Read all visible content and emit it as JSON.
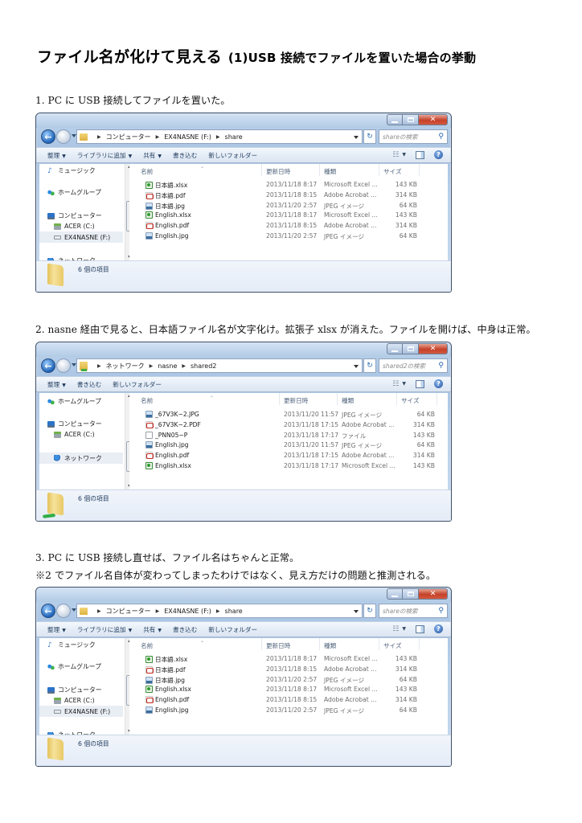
{
  "document": {
    "title": "ファイル名が化けて見える",
    "subtitle": "(1)USB 接続でファイルを置いた場合の挙動",
    "steps": [
      {
        "text": "1.  PC に USB 接続してファイルを置いた。"
      },
      {
        "text": "2.  nasne 経由で見ると、日本語ファイル名が文字化け。拡張子 xlsx が消えた。ファイルを開けば、中身は正常。"
      },
      {
        "text": "3.  PC に USB 接続し直せば、ファイル名はちゃんと正常。"
      },
      {
        "text": "※2 でファイル名自体が変わってしまったわけではなく、見え方だけの問題と推測される。"
      }
    ]
  },
  "windows": [
    {
      "breadcrumb": [
        "コンピューター",
        "EX4NASNE (F:)",
        "share"
      ],
      "search_placeholder": "shareの検索",
      "commands": [
        {
          "label": "整理",
          "dropdown": true
        },
        {
          "label": "ライブラリに追加",
          "dropdown": true
        },
        {
          "label": "共有",
          "dropdown": true
        },
        {
          "label": "書き込む",
          "dropdown": false
        },
        {
          "label": "新しいフォルダー",
          "dropdown": false
        }
      ],
      "nav_items": [
        {
          "label": "ミュージック",
          "icon": "music-icon"
        },
        {
          "label": "ホームグループ",
          "icon": "homegroup-icon"
        },
        {
          "label": "コンピューター",
          "icon": "computer-icon"
        },
        {
          "label": "ACER (C:)",
          "icon": "drive-icon"
        },
        {
          "label": "EX4NASNE (F:)",
          "icon": "usb-drive-icon",
          "selected": true
        },
        {
          "label": "ネットワーク",
          "icon": "network-icon"
        }
      ],
      "columns": [
        "名前",
        "更新日時",
        "種類",
        "サイズ"
      ],
      "files": [
        {
          "name": "日本語.xlsx",
          "date": "2013/11/18 8:17",
          "type": "Microsoft Excel ...",
          "size": "143 KB",
          "icon": "excel"
        },
        {
          "name": "日本語.pdf",
          "date": "2013/11/18 8:15",
          "type": "Adobe Acrobat ...",
          "size": "314 KB",
          "icon": "pdf"
        },
        {
          "name": "日本語.jpg",
          "date": "2013/11/20 2:57",
          "type": "JPEG イメージ",
          "size": "64 KB",
          "icon": "jpg"
        },
        {
          "name": "English.xlsx",
          "date": "2013/11/18 8:17",
          "type": "Microsoft Excel ...",
          "size": "143 KB",
          "icon": "excel"
        },
        {
          "name": "English.pdf",
          "date": "2013/11/18 8:15",
          "type": "Adobe Acrobat ...",
          "size": "314 KB",
          "icon": "pdf"
        },
        {
          "name": "English.jpg",
          "date": "2013/11/20 2:57",
          "type": "JPEG イメージ",
          "size": "64 KB",
          "icon": "jpg"
        }
      ],
      "status": "6 個の項目"
    },
    {
      "breadcrumb": [
        "ネットワーク",
        "nasne",
        "shared2"
      ],
      "search_placeholder": "shared2の検索",
      "commands": [
        {
          "label": "整理",
          "dropdown": true
        },
        {
          "label": "書き込む",
          "dropdown": false
        },
        {
          "label": "新しいフォルダー",
          "dropdown": false
        }
      ],
      "nav_items": [
        {
          "label": "ホームグループ",
          "icon": "homegroup-icon"
        },
        {
          "label": "コンピューター",
          "icon": "computer-icon"
        },
        {
          "label": "ACER (C:)",
          "icon": "drive-icon"
        },
        {
          "label": "ネットワーク",
          "icon": "network-icon",
          "selected": true
        }
      ],
      "columns": [
        "名前",
        "更新日時",
        "種類",
        "サイズ"
      ],
      "files": [
        {
          "name": "_67V3K~2.JPG",
          "date": "2013/11/20 11:57",
          "type": "JPEG イメージ",
          "size": "64 KB",
          "icon": "jpg"
        },
        {
          "name": "_67V3K~2.PDF",
          "date": "2013/11/18 17:15",
          "type": "Adobe Acrobat ...",
          "size": "314 KB",
          "icon": "pdf"
        },
        {
          "name": "_PNN05~P",
          "date": "2013/11/18 17:17",
          "type": "ファイル",
          "size": "143 KB",
          "icon": "blank"
        },
        {
          "name": "English.jpg",
          "date": "2013/11/20 11:57",
          "type": "JPEG イメージ",
          "size": "64 KB",
          "icon": "jpg"
        },
        {
          "name": "English.pdf",
          "date": "2013/11/18 17:15",
          "type": "Adobe Acrobat ...",
          "size": "314 KB",
          "icon": "pdf"
        },
        {
          "name": "English.xlsx",
          "date": "2013/11/18 17:17",
          "type": "Microsoft Excel ...",
          "size": "143 KB",
          "icon": "excel"
        }
      ],
      "status": "6 個の項目"
    },
    {
      "breadcrumb": [
        "コンピューター",
        "EX4NASNE (F:)",
        "share"
      ],
      "search_placeholder": "shareの検索",
      "commands": [
        {
          "label": "整理",
          "dropdown": true
        },
        {
          "label": "ライブラリに追加",
          "dropdown": true
        },
        {
          "label": "共有",
          "dropdown": true
        },
        {
          "label": "書き込む",
          "dropdown": false
        },
        {
          "label": "新しいフォルダー",
          "dropdown": false
        }
      ],
      "nav_items": [
        {
          "label": "ミュージック",
          "icon": "music-icon"
        },
        {
          "label": "ホームグループ",
          "icon": "homegroup-icon"
        },
        {
          "label": "コンピューター",
          "icon": "computer-icon"
        },
        {
          "label": "ACER (C:)",
          "icon": "drive-icon"
        },
        {
          "label": "EX4NASNE (F:)",
          "icon": "usb-drive-icon",
          "selected": true
        },
        {
          "label": "ネットワーク",
          "icon": "network-icon"
        }
      ],
      "columns": [
        "名前",
        "更新日時",
        "種類",
        "サイズ"
      ],
      "files": [
        {
          "name": "日本語.xlsx",
          "date": "2013/11/18 8:17",
          "type": "Microsoft Excel ...",
          "size": "143 KB",
          "icon": "excel"
        },
        {
          "name": "日本語.pdf",
          "date": "2013/11/18 8:15",
          "type": "Adobe Acrobat ...",
          "size": "314 KB",
          "icon": "pdf"
        },
        {
          "name": "日本語.jpg",
          "date": "2013/11/20 2:57",
          "type": "JPEG イメージ",
          "size": "64 KB",
          "icon": "jpg"
        },
        {
          "name": "English.xlsx",
          "date": "2013/11/18 8:17",
          "type": "Microsoft Excel ...",
          "size": "143 KB",
          "icon": "excel"
        },
        {
          "name": "English.pdf",
          "date": "2013/11/18 8:15",
          "type": "Adobe Acrobat ...",
          "size": "314 KB",
          "icon": "pdf"
        },
        {
          "name": "English.jpg",
          "date": "2013/11/20 2:57",
          "type": "JPEG イメージ",
          "size": "64 KB",
          "icon": "jpg"
        }
      ],
      "status": "6 個の項目"
    }
  ]
}
